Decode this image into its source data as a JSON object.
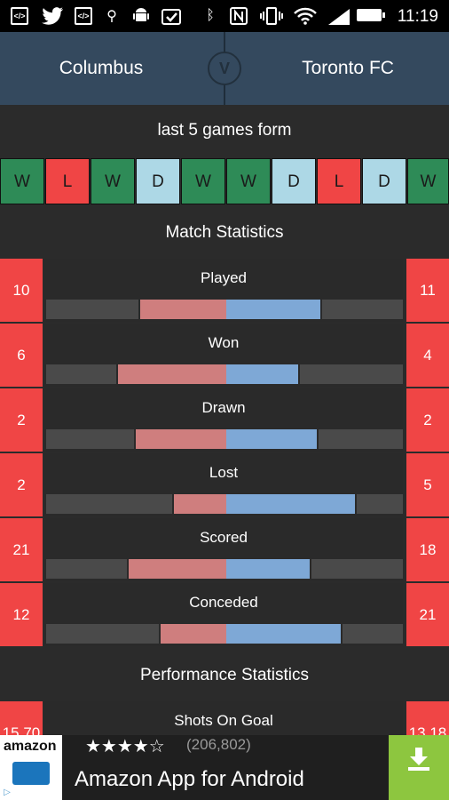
{
  "status_bar": {
    "time": "11:19",
    "icons": [
      "code-icon",
      "twitter-icon",
      "code-icon",
      "usb-icon",
      "android-icon",
      "clipboard-check-icon",
      "bluetooth-icon",
      "nfc-icon",
      "vibrate-icon",
      "wifi-icon",
      "signal-icon",
      "battery-icon"
    ]
  },
  "header": {
    "home": "Columbus",
    "away": "Toronto FC"
  },
  "form": {
    "title": "last 5 games form",
    "home": [
      "W",
      "L",
      "W",
      "D",
      "W"
    ],
    "away": [
      "W",
      "D",
      "L",
      "D",
      "W"
    ]
  },
  "match_stats": {
    "title": "Match Statistics",
    "rows": [
      {
        "label": "Played",
        "home": "10",
        "away": "11"
      },
      {
        "label": "Won",
        "home": "6",
        "away": "4"
      },
      {
        "label": "Drawn",
        "home": "2",
        "away": "2"
      },
      {
        "label": "Lost",
        "home": "2",
        "away": "5"
      },
      {
        "label": "Scored",
        "home": "21",
        "away": "18"
      },
      {
        "label": "Conceded",
        "home": "12",
        "away": "21"
      }
    ]
  },
  "performance": {
    "title": "Performance Statistics",
    "rows": [
      {
        "label": "Shots On Goal",
        "home": "15.70",
        "away": "13.18"
      }
    ]
  },
  "ad": {
    "logo": "amazon",
    "rating_stars": "★★★★☆",
    "reviews": "(206,802)",
    "title": "Amazon App for Android"
  },
  "colors": {
    "win": "#2e8b57",
    "loss": "#f04545",
    "draw": "#add8e6",
    "header": "#34495e",
    "home_bar": "#cf7e7e",
    "away_bar": "#7ea8d6"
  }
}
